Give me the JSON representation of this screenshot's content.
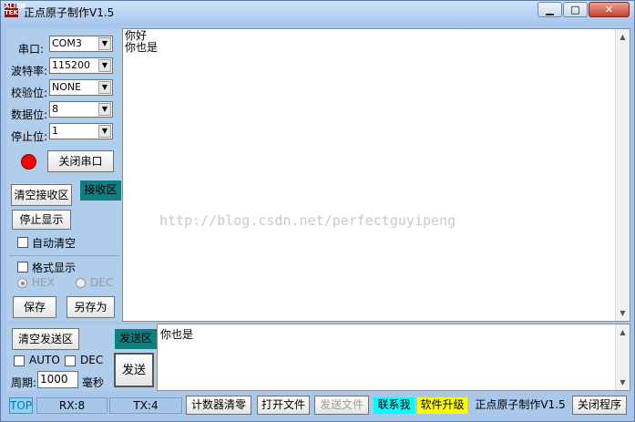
{
  "window": {
    "title": "正点原子制作V1.5",
    "app_icon_text": "ALIEN TEK",
    "min_symbol": "▁",
    "max_symbol": "□",
    "close_symbol": "✕"
  },
  "settings": {
    "port_label": "串口:",
    "port_value": "COM3",
    "baud_label": "波特率:",
    "baud_value": "115200",
    "parity_label": "校验位:",
    "parity_value": "NONE",
    "databits_label": "数据位:",
    "databits_value": "8",
    "stopbits_label": "停止位:",
    "stopbits_value": "1",
    "status_color": "#ff0000",
    "close_port_label": "关闭串口"
  },
  "receive": {
    "clear_label": "清空接收区",
    "area_label": "接收区",
    "stop_display_label": "停止显示",
    "auto_clear_label": "自动清空",
    "format_label": "格式显示",
    "hex_label": "HEX",
    "dec_label": "DEC",
    "save_label": "保存",
    "save_as_label": "另存为",
    "content": "你好\n你也是",
    "watermark": "http://blog.csdn.net/perfectguyipeng"
  },
  "send": {
    "clear_label": "清空发送区",
    "area_label": "发送区",
    "send_label": "发送",
    "auto_label": "AUTO",
    "dec_label": "DEC",
    "period_label": "周期:",
    "period_value": "1000",
    "unit_label": "毫秒",
    "content": "你也是"
  },
  "statusbar": {
    "top_label": "TOP",
    "rx": "RX:8",
    "tx": "TX:4",
    "counter_clear": "计数器清零",
    "open_file": "打开文件",
    "send_file": "发送文件",
    "contact": "联系我",
    "upgrade": "软件升级",
    "credit": "正点原子制作V1.5",
    "close_app": "关闭程序"
  }
}
